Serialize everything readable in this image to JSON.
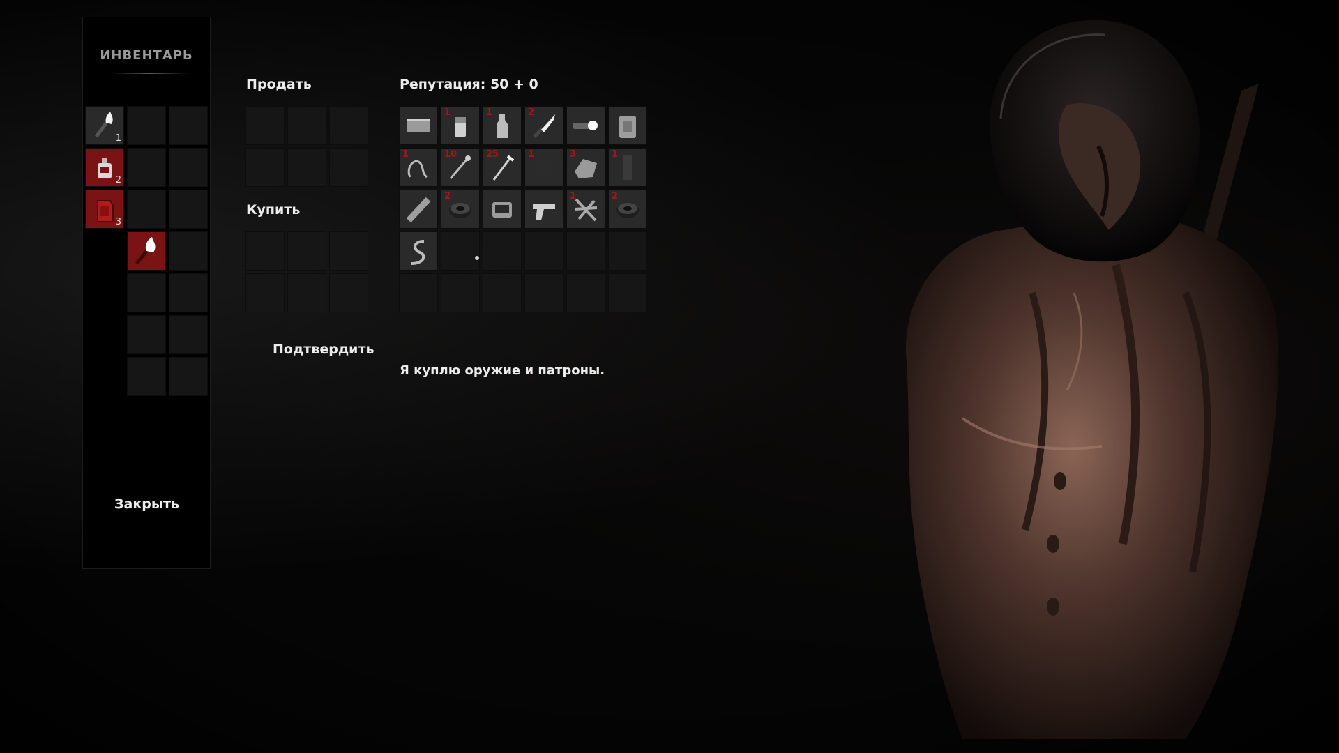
{
  "inventory": {
    "title": "ИНВЕНТАРЬ",
    "close_label": "Закрыть",
    "slots": [
      {
        "icon": "torch-icon",
        "qty": "1",
        "style": "filled"
      },
      {
        "icon": "lantern-icon",
        "qty": "2",
        "style": "red"
      },
      {
        "icon": "fuel-canister-icon",
        "qty": "3",
        "style": "red"
      },
      {
        "icon": "torch-icon",
        "qty": "",
        "style": "red"
      }
    ]
  },
  "trade": {
    "sell_label": "Продать",
    "buy_label": "Купить",
    "confirm_label": "Подтвердить"
  },
  "trader": {
    "reputation_label": "Репутация: 50 + 0",
    "message": "Я куплю оружие и патроны.",
    "items": [
      {
        "icon": "ammo-box-icon",
        "qty": ""
      },
      {
        "icon": "lighter-icon",
        "qty": "1"
      },
      {
        "icon": "bottle-icon",
        "qty": "1"
      },
      {
        "icon": "knife-icon",
        "qty": "2"
      },
      {
        "icon": "flashlight-icon",
        "qty": ""
      },
      {
        "icon": "jerrycan-icon",
        "qty": ""
      },
      {
        "icon": "wire-icon",
        "qty": "1"
      },
      {
        "icon": "match-icon",
        "qty": "10"
      },
      {
        "icon": "nail-icon",
        "qty": "25"
      },
      {
        "icon": "stone-icon",
        "qty": "1"
      },
      {
        "icon": "rag-icon",
        "qty": "3"
      },
      {
        "icon": "magazine-icon",
        "qty": "1"
      },
      {
        "icon": "pipe-icon",
        "qty": ""
      },
      {
        "icon": "tape-roll-icon",
        "qty": "2"
      },
      {
        "icon": "watch-icon",
        "qty": ""
      },
      {
        "icon": "pistol-icon",
        "qty": ""
      },
      {
        "icon": "scrap-icon",
        "qty": "1"
      },
      {
        "icon": "tape-roll-icon",
        "qty": "2"
      },
      {
        "icon": "rope-icon",
        "qty": ""
      }
    ]
  },
  "colors": {
    "accent_red": "#7a1414",
    "qty_red": "#a01818",
    "slot_bg": "#161616"
  }
}
